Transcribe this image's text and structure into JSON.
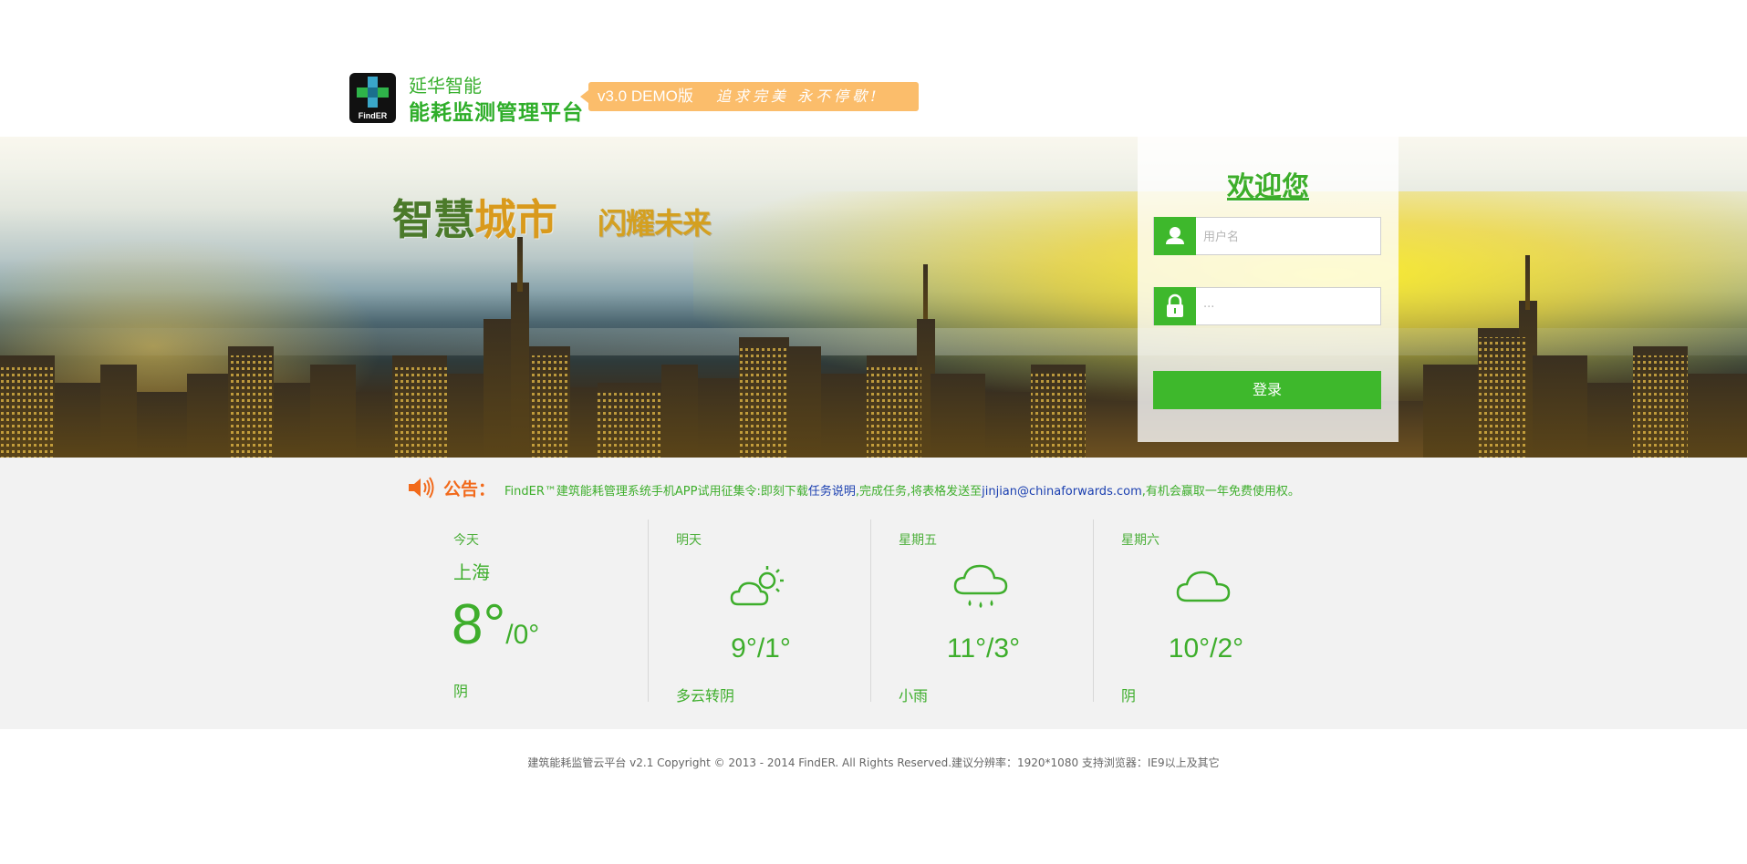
{
  "header": {
    "logo_brand": "FindER",
    "company": "延华智能",
    "platform": "能耗监测管理平台",
    "version": "v3.0 DEMO版",
    "slogan": "追求完美 永不停歇!"
  },
  "banner": {
    "headline_part1": "智慧",
    "headline_part2": "城市",
    "subline": "闪耀未来"
  },
  "login": {
    "welcome": "欢迎您",
    "username_placeholder": "用户名",
    "password_placeholder": "···",
    "submit_label": "登录"
  },
  "notice": {
    "label": "公告：",
    "text_before": "FindER™建筑能耗管理系统手机APP试用征集令:即刻下载",
    "link1": "任务说明",
    "text_middle": ",完成任务,将表格发送至",
    "link2": "jinjian@chinaforwards.com",
    "text_after": ",有机会赢取一年免费使用权。"
  },
  "weather": {
    "days": [
      {
        "name": "今天",
        "city": "上海",
        "high": "8°",
        "low": "/0°",
        "condition": "阴",
        "icon": "none"
      },
      {
        "name": "明天",
        "temp": "9°/1°",
        "condition": "多云转阴",
        "icon": "partly-cloudy-icon"
      },
      {
        "name": "星期五",
        "temp": "11°/3°",
        "condition": "小雨",
        "icon": "rain-icon"
      },
      {
        "name": "星期六",
        "temp": "10°/2°",
        "condition": "阴",
        "icon": "cloud-icon"
      }
    ]
  },
  "footer": {
    "text": "建筑能耗监管云平台 v2.1 Copyright © 2013 - 2014 FindER. All Rights Reserved.建议分辨率：1920*1080 支持浏览器：IE9以上及其它"
  },
  "colors": {
    "brand_green": "#3eb82c",
    "notice_orange": "#f26a1b",
    "banner_orange": "#fbbd6b",
    "link_blue": "#1a3fb0"
  }
}
